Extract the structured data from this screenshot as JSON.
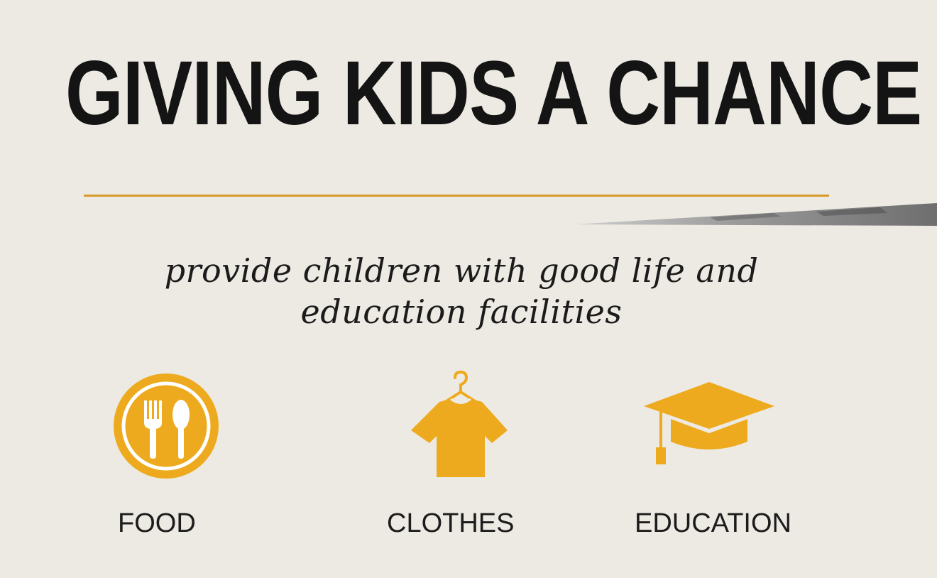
{
  "title": "GIVING KIDS A CHANCE",
  "subtitle": {
    "line1": "provide children with good life and",
    "line2": "education facilities"
  },
  "items": [
    {
      "label": "FOOD",
      "icon": "food-plate-icon"
    },
    {
      "label": "CLOTHES",
      "icon": "shirt-hanger-icon"
    },
    {
      "label": "EDUCATION",
      "icon": "graduation-cap-icon"
    }
  ],
  "colors": {
    "background": "#edeae3",
    "accent": "#eeaa1e",
    "divider": "#d69a2a",
    "text": "#141414"
  }
}
